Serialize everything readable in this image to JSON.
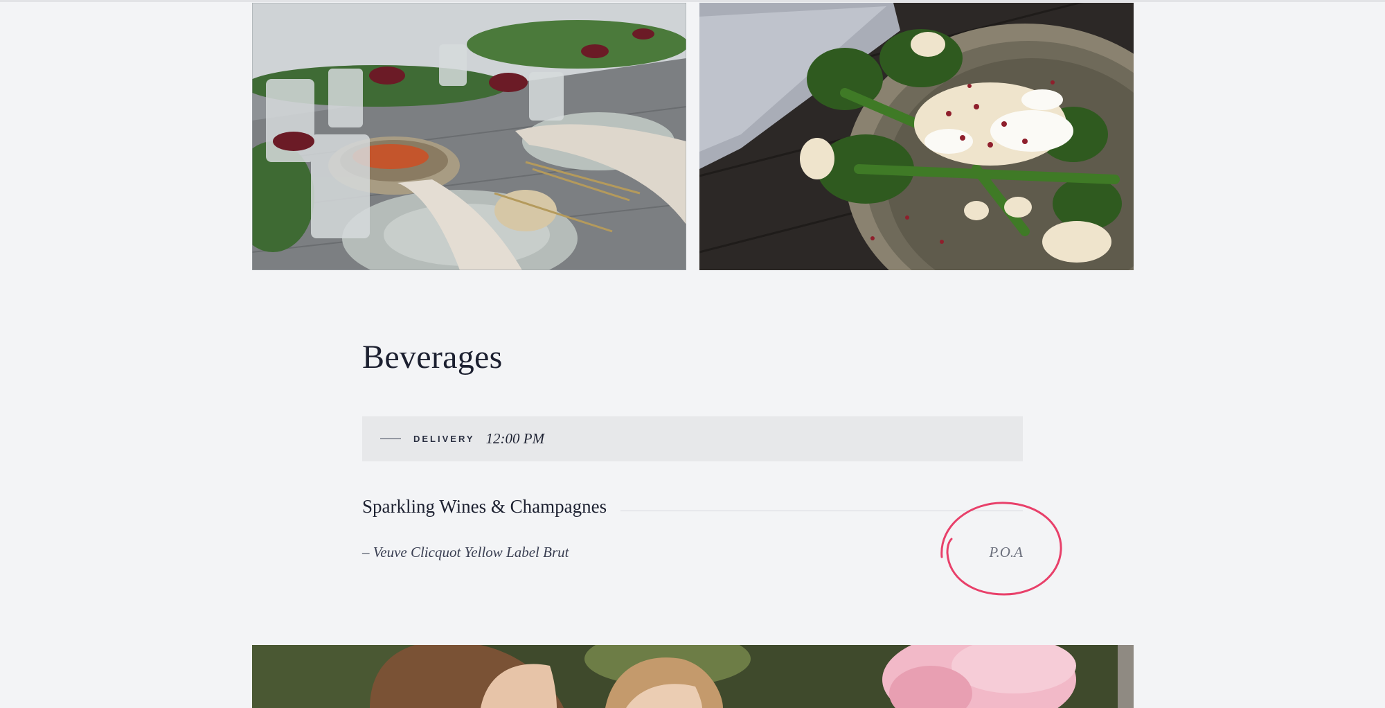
{
  "images": {
    "table_setting": "table-setting-photo",
    "broccoli_plate": "broccolini-dish-photo",
    "guests": "guests-photo"
  },
  "beverages": {
    "title": "Beverages",
    "delivery": {
      "label": "DELIVERY",
      "time": "12:00 PM"
    },
    "categories": [
      {
        "name": "Sparkling Wines & Champagnes",
        "items": [
          {
            "name": "– Veuve Clicquot Yellow Label Brut",
            "price": "P.O.A"
          }
        ]
      }
    ]
  },
  "colors": {
    "background": "#f3f4f6",
    "delivery_bar": "#e7e8ea",
    "annotation_circle": "#e8406a",
    "text_dark": "#1c2030"
  }
}
